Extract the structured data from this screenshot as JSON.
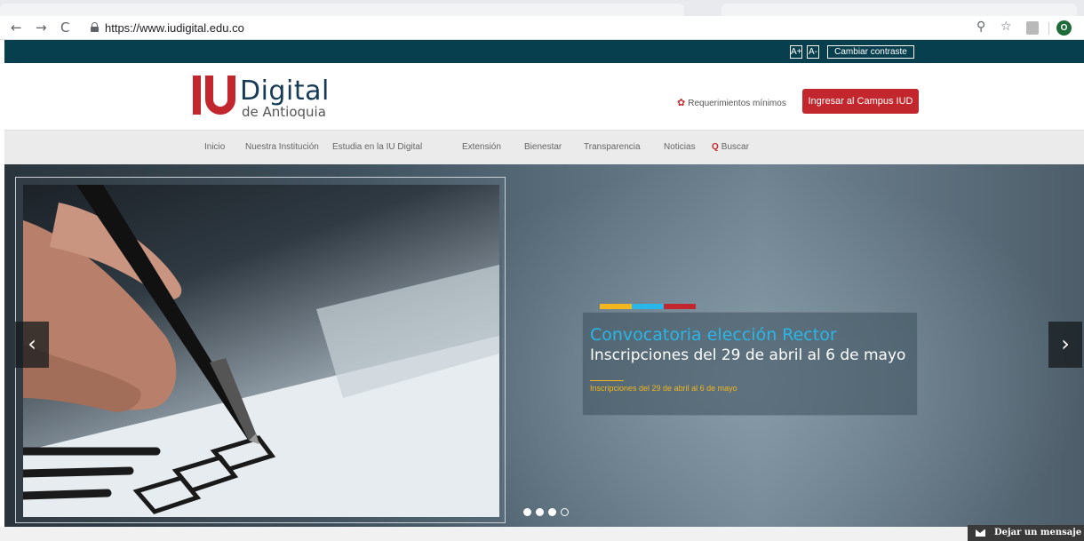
{
  "browser": {
    "url": "https://www.iudigital.edu.co",
    "profile_initial": "O",
    "icons": {
      "back": "←",
      "forward": "→",
      "reload": "C",
      "zoom": "⚲",
      "star": "☆"
    }
  },
  "accessibility": {
    "increase_font": "A+",
    "decrease_font": "A-",
    "contrast": "Cambiar contraste"
  },
  "header": {
    "logo_main": "Digital",
    "logo_sub": "de Antioquia",
    "requirements": "Requerimientos mínimos",
    "campus_button": "Ingresar al Campus IUD",
    "accent_color": "#c1272d"
  },
  "nav": {
    "items": [
      "Inicio",
      "Nuestra Institución",
      "Estudia en la IU Digital",
      "Extensión",
      "Bienestar",
      "Transparencia",
      "Noticias"
    ],
    "search": "Buscar"
  },
  "hero": {
    "title": "Convocatoria elección Rector",
    "subtitle": "Inscripciones del 29 de abril al 6 de mayo",
    "detail": "Inscripciones del 29 de abril al 6 de mayo",
    "prev": "‹",
    "next": "›",
    "slides_total": 4,
    "slide_active": 4,
    "stripe_colors": [
      "#f3b61c",
      "#29b6e8",
      "#c1272d"
    ]
  },
  "chat": {
    "label": "Dejar un mensaje"
  }
}
